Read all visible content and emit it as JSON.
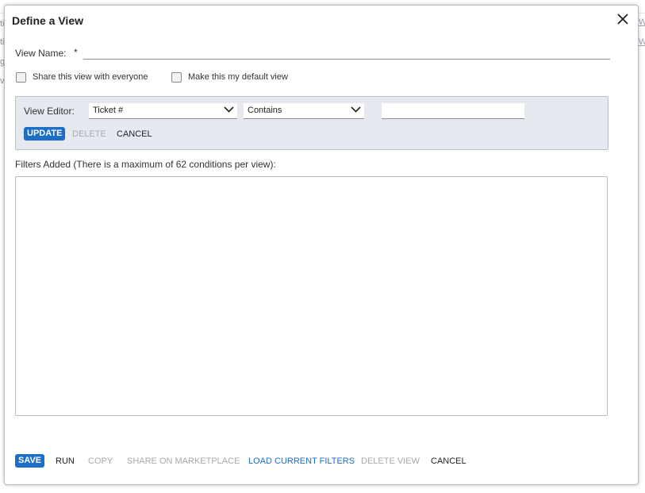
{
  "background": {
    "left_fragments": [
      "ti",
      "ti",
      "g",
      "v"
    ],
    "right_links": [
      "W",
      "W"
    ]
  },
  "dialog": {
    "title": "Define a View",
    "close_icon": "close-icon",
    "view_name": {
      "label": "View Name:",
      "required_marker": "*",
      "value": "",
      "placeholder": ""
    },
    "options": {
      "share_label": "Share this view with everyone",
      "share_checked": false,
      "default_label": "Make this my default view",
      "default_checked": false
    },
    "view_editor": {
      "label": "View Editor:",
      "field_select": "Ticket #",
      "operator_select": "Contains",
      "value": "",
      "update_label": "UPDATE",
      "delete_label": "DELETE",
      "cancel_label": "CANCEL"
    },
    "filters": {
      "label": "Filters Added (There is a maximum of 62 conditions per view):",
      "items": []
    },
    "footer": {
      "save": "SAVE",
      "run": "RUN",
      "copy": "COPY",
      "share_marketplace": "SHARE ON MARKETPLACE",
      "load_filters": "LOAD CURRENT FILTERS",
      "delete_view": "DELETE VIEW",
      "cancel": "CANCEL"
    },
    "colors": {
      "primary": "#1d6fc6",
      "panel_bg": "#e6eaf0",
      "disabled": "#a7a9ac"
    }
  }
}
